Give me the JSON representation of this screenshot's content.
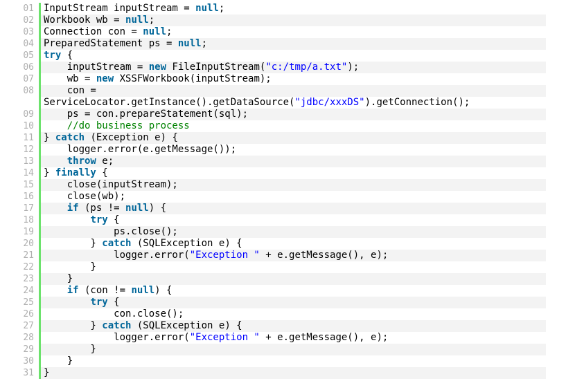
{
  "colors": {
    "keyword": "#006699",
    "string": "#0000ff",
    "comment": "#008200",
    "line_number": "#afafaf",
    "gutter_bar": "#6ce26c",
    "alt_row": "#f3f3f3"
  },
  "lines": [
    {
      "no": "01",
      "tokens": [
        [
          "p",
          "InputStream inputStream = "
        ],
        [
          "k",
          "null"
        ],
        [
          "p",
          ";"
        ]
      ]
    },
    {
      "no": "02",
      "tokens": [
        [
          "p",
          "Workbook wb = "
        ],
        [
          "k",
          "null"
        ],
        [
          "p",
          ";"
        ]
      ]
    },
    {
      "no": "03",
      "tokens": [
        [
          "p",
          "Connection con = "
        ],
        [
          "k",
          "null"
        ],
        [
          "p",
          ";"
        ]
      ]
    },
    {
      "no": "04",
      "tokens": [
        [
          "p",
          "PreparedStatement ps = "
        ],
        [
          "k",
          "null"
        ],
        [
          "p",
          ";"
        ]
      ]
    },
    {
      "no": "05",
      "tokens": [
        [
          "k",
          "try"
        ],
        [
          "p",
          " {"
        ]
      ]
    },
    {
      "no": "06",
      "tokens": [
        [
          "p",
          "    inputStream = "
        ],
        [
          "k",
          "new"
        ],
        [
          "p",
          " FileInputStream("
        ],
        [
          "s",
          "\"c:/tmp/a.txt\""
        ],
        [
          "p",
          ");"
        ]
      ]
    },
    {
      "no": "07",
      "tokens": [
        [
          "p",
          "    wb = "
        ],
        [
          "k",
          "new"
        ],
        [
          "p",
          " XSSFWorkbook(inputStream);"
        ]
      ]
    },
    {
      "no": "08",
      "tokens": [
        [
          "p",
          "    con ="
        ]
      ]
    },
    {
      "no": "",
      "tokens": [
        [
          "p",
          "ServiceLocator.getInstance().getDataSource("
        ],
        [
          "s",
          "\"jdbc/xxxDS\""
        ],
        [
          "p",
          ").getConnection();"
        ]
      ]
    },
    {
      "no": "09",
      "tokens": [
        [
          "p",
          "    ps = con.prepareStatement(sql);"
        ]
      ]
    },
    {
      "no": "10",
      "tokens": [
        [
          "c",
          "    //do business process"
        ]
      ]
    },
    {
      "no": "11",
      "tokens": [
        [
          "p",
          "} "
        ],
        [
          "k",
          "catch"
        ],
        [
          "p",
          " (Exception e) {"
        ]
      ]
    },
    {
      "no": "12",
      "tokens": [
        [
          "p",
          "    logger.error(e.getMessage());"
        ]
      ]
    },
    {
      "no": "13",
      "tokens": [
        [
          "p",
          "    "
        ],
        [
          "k",
          "throw"
        ],
        [
          "p",
          " e;"
        ]
      ]
    },
    {
      "no": "14",
      "tokens": [
        [
          "p",
          "} "
        ],
        [
          "k",
          "finally"
        ],
        [
          "p",
          " {"
        ]
      ]
    },
    {
      "no": "15",
      "tokens": [
        [
          "p",
          "    close(inputStream);"
        ]
      ]
    },
    {
      "no": "16",
      "tokens": [
        [
          "p",
          "    close(wb);"
        ]
      ]
    },
    {
      "no": "17",
      "tokens": [
        [
          "p",
          "    "
        ],
        [
          "k",
          "if"
        ],
        [
          "p",
          " (ps != "
        ],
        [
          "k",
          "null"
        ],
        [
          "p",
          ") {"
        ]
      ]
    },
    {
      "no": "18",
      "tokens": [
        [
          "p",
          "        "
        ],
        [
          "k",
          "try"
        ],
        [
          "p",
          " {"
        ]
      ]
    },
    {
      "no": "19",
      "tokens": [
        [
          "p",
          "            ps.close();"
        ]
      ]
    },
    {
      "no": "20",
      "tokens": [
        [
          "p",
          "        } "
        ],
        [
          "k",
          "catch"
        ],
        [
          "p",
          " (SQLException e) {"
        ]
      ]
    },
    {
      "no": "21",
      "tokens": [
        [
          "p",
          "            logger.error("
        ],
        [
          "s",
          "\"Exception \""
        ],
        [
          "p",
          " + e.getMessage(), e);"
        ]
      ]
    },
    {
      "no": "22",
      "tokens": [
        [
          "p",
          "        }"
        ]
      ]
    },
    {
      "no": "23",
      "tokens": [
        [
          "p",
          "    }"
        ]
      ]
    },
    {
      "no": "24",
      "tokens": [
        [
          "p",
          "    "
        ],
        [
          "k",
          "if"
        ],
        [
          "p",
          " (con != "
        ],
        [
          "k",
          "null"
        ],
        [
          "p",
          ") {"
        ]
      ]
    },
    {
      "no": "25",
      "tokens": [
        [
          "p",
          "        "
        ],
        [
          "k",
          "try"
        ],
        [
          "p",
          " {"
        ]
      ]
    },
    {
      "no": "26",
      "tokens": [
        [
          "p",
          "            con.close();"
        ]
      ]
    },
    {
      "no": "27",
      "tokens": [
        [
          "p",
          "        } "
        ],
        [
          "k",
          "catch"
        ],
        [
          "p",
          " (SQLException e) {"
        ]
      ]
    },
    {
      "no": "28",
      "tokens": [
        [
          "p",
          "            logger.error("
        ],
        [
          "s",
          "\"Exception \""
        ],
        [
          "p",
          " + e.getMessage(), e);"
        ]
      ]
    },
    {
      "no": "29",
      "tokens": [
        [
          "p",
          "        }"
        ]
      ]
    },
    {
      "no": "30",
      "tokens": [
        [
          "p",
          "    }"
        ]
      ]
    },
    {
      "no": "31",
      "tokens": [
        [
          "p",
          "}"
        ]
      ]
    }
  ]
}
